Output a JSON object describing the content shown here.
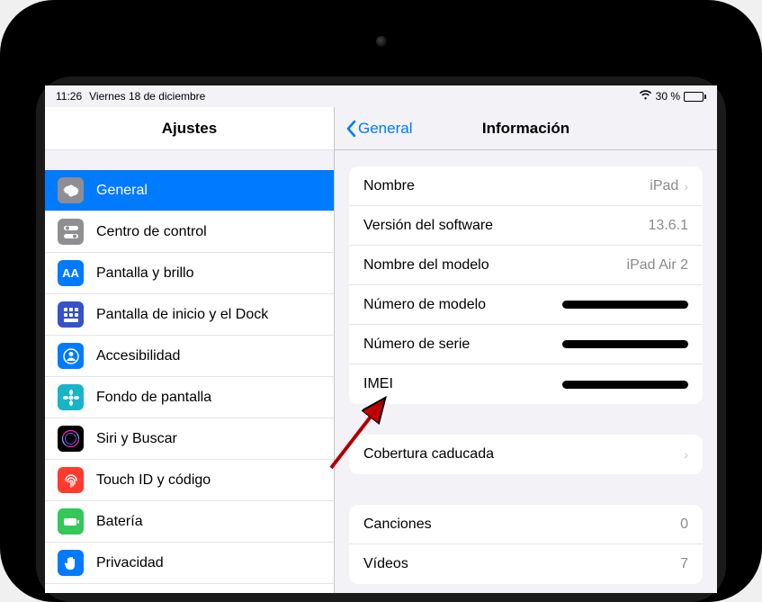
{
  "status": {
    "time": "11:26",
    "date": "Viernes 18 de diciembre",
    "battery_pct": "30 %"
  },
  "sidebar": {
    "title": "Ajustes",
    "items": [
      {
        "label": "General",
        "icon": "gear",
        "color": "#8e8e93",
        "selected": true
      },
      {
        "label": "Centro de control",
        "icon": "switches",
        "color": "#8e8e93"
      },
      {
        "label": "Pantalla y brillo",
        "icon": "AA",
        "color": "#007aff"
      },
      {
        "label": "Pantalla de inicio y el Dock",
        "icon": "grid",
        "color": "#3651c9"
      },
      {
        "label": "Accesibilidad",
        "icon": "person",
        "color": "#007aff"
      },
      {
        "label": "Fondo de pantalla",
        "icon": "flower",
        "color": "#18b5c9"
      },
      {
        "label": "Siri y Buscar",
        "icon": "siri",
        "color": "#000000"
      },
      {
        "label": "Touch ID y código",
        "icon": "fingerprint",
        "color": "#ff3b30"
      },
      {
        "label": "Batería",
        "icon": "battery",
        "color": "#34c759"
      },
      {
        "label": "Privacidad",
        "icon": "hand",
        "color": "#007aff"
      }
    ]
  },
  "detail": {
    "back": "General",
    "title": "Información",
    "groups": [
      [
        {
          "label": "Nombre",
          "value": "iPad",
          "chevron": true
        },
        {
          "label": "Versión del software",
          "value": "13.6.1"
        },
        {
          "label": "Nombre del modelo",
          "value": "iPad Air 2"
        },
        {
          "label": "Número de modelo",
          "redacted": true
        },
        {
          "label": "Número de serie",
          "redacted": true
        },
        {
          "label": "IMEI",
          "redacted": true
        }
      ],
      [
        {
          "label": "Cobertura caducada",
          "value": "",
          "chevron": true
        }
      ],
      [
        {
          "label": "Canciones",
          "value": "0"
        },
        {
          "label": "Vídeos",
          "value": "7"
        }
      ]
    ]
  }
}
